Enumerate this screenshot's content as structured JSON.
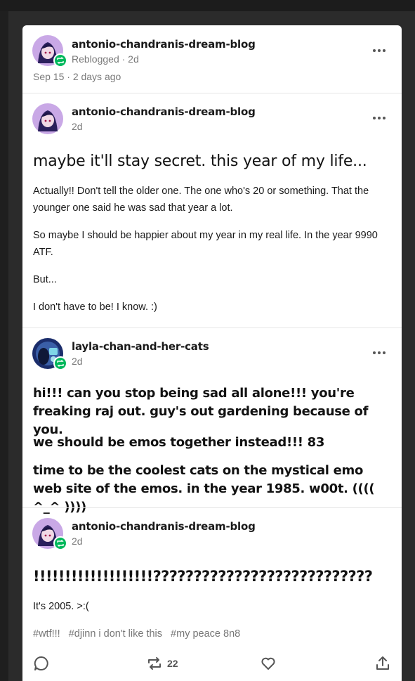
{
  "post_header": {
    "blog": "antonio-chandranis-dream-blog",
    "status": "Reblogged · 2d",
    "date": "Sep 15 · 2 days ago"
  },
  "entries": [
    {
      "blog": "antonio-chandranis-dream-blog",
      "time": "2d",
      "title": "maybe it'll stay secret. this year of my life...",
      "paragraphs": [
        "Actually!! Don't tell the older one. The one who's 20 or something. That the younger one said he was sad that year a lot.",
        "So maybe I should be happier about my year in my real life. In the year 9990 ATF.",
        "But...",
        "I don't have to be! I know. :)"
      ]
    },
    {
      "blog": "layla-chan-and-her-cats",
      "time": "2d",
      "paragraphs": [
        "hi!!! can you stop being sad all alone!!! you're freaking raj out. guy's out gardening because of you.",
        "we should be emos together instead!!! 83",
        "time to be the coolest cats on the mystical emo web site of the emos. in the year 1985. w00t. (((( ^_^ ))))"
      ]
    },
    {
      "blog": "antonio-chandranis-dream-blog",
      "time": "2d",
      "title": "!!!!!!!!!!!!!!!!!!!???????????????????????????",
      "paragraphs": [
        "It's 2005. >:("
      ]
    }
  ],
  "tags": [
    "#wtf!!!",
    "#djinn i don't like this",
    "#my peace 8n8"
  ],
  "actions": {
    "reblog_count": "22",
    "icons": [
      "comment-icon",
      "reblog-icon",
      "heart-icon",
      "share-icon"
    ]
  },
  "colors": {
    "reblog_green": "#00b85c",
    "background": "#1f1f1f",
    "card": "#ffffff"
  }
}
